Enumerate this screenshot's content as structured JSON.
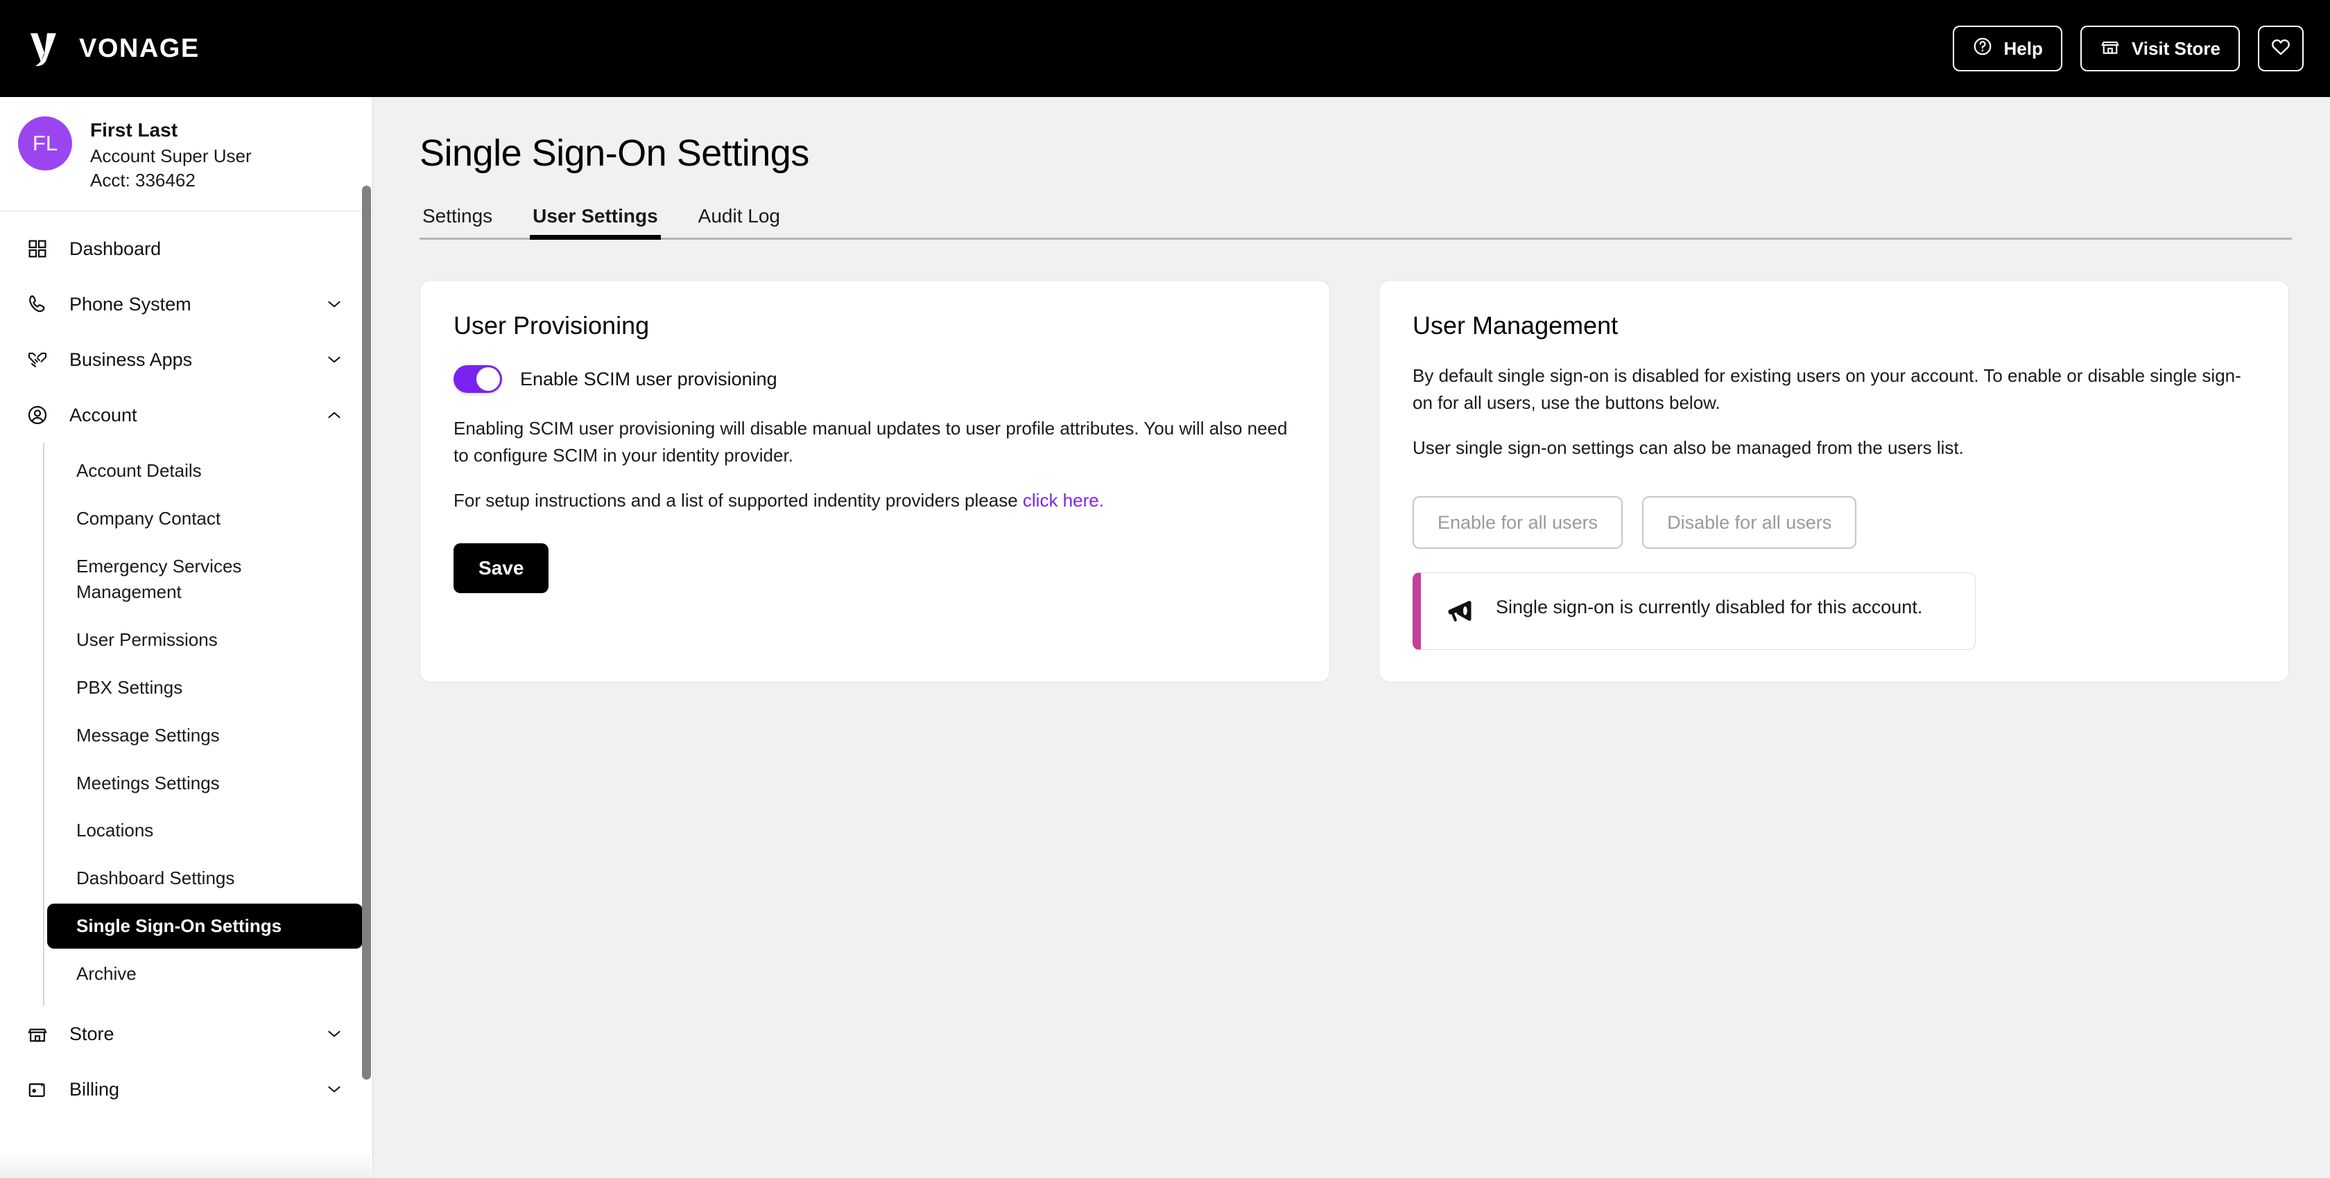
{
  "header": {
    "brand": "VONAGE",
    "help_label": "Help",
    "store_label": "Visit Store"
  },
  "sidebar": {
    "profile": {
      "initials": "FL",
      "name": "First Last",
      "role": "Account Super User",
      "account": "Acct: 336462"
    },
    "nav": [
      {
        "label": "Dashboard",
        "icon": "grid-icon",
        "chevron": "none"
      },
      {
        "label": "Phone System",
        "icon": "phone-icon",
        "chevron": "down"
      },
      {
        "label": "Business Apps",
        "icon": "handshake-icon",
        "chevron": "down"
      },
      {
        "label": "Account",
        "icon": "user-circle-icon",
        "chevron": "up"
      }
    ],
    "account_subnav": [
      {
        "label": "Account Details",
        "active": false
      },
      {
        "label": "Company Contact",
        "active": false
      },
      {
        "label": "Emergency Services Management",
        "active": false
      },
      {
        "label": "User Permissions",
        "active": false
      },
      {
        "label": "PBX Settings",
        "active": false
      },
      {
        "label": "Message Settings",
        "active": false
      },
      {
        "label": "Meetings Settings",
        "active": false
      },
      {
        "label": "Locations",
        "active": false
      },
      {
        "label": "Dashboard Settings",
        "active": false
      },
      {
        "label": "Single Sign-On Settings",
        "active": true
      },
      {
        "label": "Archive",
        "active": false
      }
    ],
    "nav_bottom": [
      {
        "label": "Store",
        "icon": "store-icon",
        "chevron": "down"
      },
      {
        "label": "Billing",
        "icon": "wallet-icon",
        "chevron": "down"
      }
    ]
  },
  "main": {
    "page_title": "Single Sign-On Settings",
    "tabs": [
      {
        "label": "Settings",
        "active": false
      },
      {
        "label": "User Settings",
        "active": true
      },
      {
        "label": "Audit Log",
        "active": false
      }
    ],
    "user_provisioning": {
      "title": "User Provisioning",
      "toggle_label": "Enable SCIM user provisioning",
      "toggle_on": true,
      "paragraph_1": "Enabling SCIM user provisioning will disable manual updates to user profile attributes. You will also need to configure SCIM in your identity provider.",
      "paragraph_2_prefix": "For setup instructions and a list of supported indentity providers please ",
      "link_text": "click here.",
      "save_label": "Save"
    },
    "user_management": {
      "title": "User Management",
      "paragraph_1": "By default single sign-on is disabled for existing users on your account. To enable or disable single sign-on for all users, use the buttons below.",
      "paragraph_2": "User single sign-on settings can also be managed from the users list.",
      "enable_all_label": "Enable for all users",
      "disable_all_label": "Disable for all users",
      "alert_text": "Single sign-on is currently disabled for this account."
    }
  },
  "colors": {
    "accent_purple": "#7a22ef",
    "link_purple": "#8024e8",
    "avatar_purple": "#9b45f0",
    "alert_magenta": "#c0409a",
    "page_bg": "#f1f1f1",
    "topbar_bg": "#000000"
  }
}
